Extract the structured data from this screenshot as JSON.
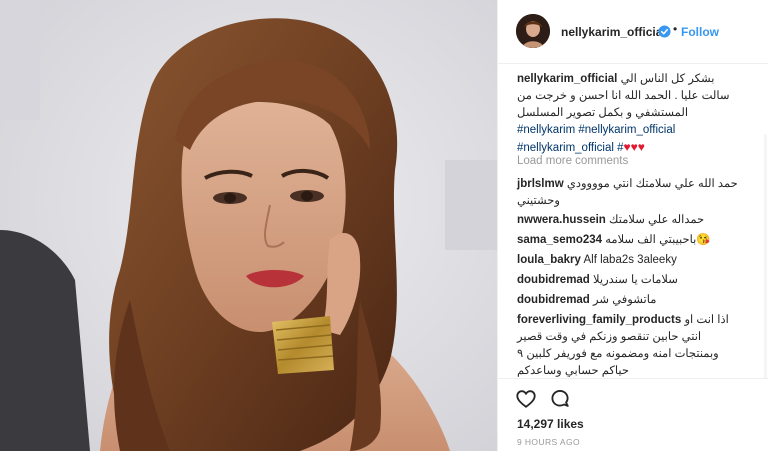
{
  "post": {
    "username": "nellykarim_official",
    "follow_label": "Follow",
    "separator": "•",
    "likes": "14,297 likes",
    "time": "9 HOURS AGO",
    "load_more": "Load more comments"
  },
  "caption": {
    "user": "nellykarim_official",
    "text_line1": "بشكر كل الناس الي",
    "text_line2": "سالت عليا . الحمد الله انا احسن و خرجت من",
    "text_line3": "المستشفي و بكمل تصوير المسلسل",
    "tags_line1": "#nellykarim #nellykarim_official",
    "tags_line2": "#nellykarim_official #",
    "hearts": "♥♥♥"
  },
  "comments": [
    {
      "user": "jbrlslmw",
      "text": "حمد الله علي سلامتك انتي موووودي",
      "text2": "وحشتيني"
    },
    {
      "user": "nwwera.hussein",
      "text": "حمداله علي سلامتك"
    },
    {
      "user": "sama_semo234",
      "text": "باحبيبتي الف سلامه",
      "emoji": "😘"
    },
    {
      "user": "loula_bakry",
      "text": "Alf laba2s 3aleeky"
    },
    {
      "user": "doubidremad",
      "text": "سلامات يا سندريلا"
    },
    {
      "user": "doubidremad",
      "text": "ماتشوفي شر"
    },
    {
      "user": "foreverliving_family_products",
      "text": "اذا انت او",
      "text2": "انتي حابين تنقصو وزنكم في وقت قصير",
      "text3": "وبمنتجات امنه ومضمونه مع فوريفر كلبين ٩",
      "text4": "حياكم حسابي وساعدكم"
    }
  ],
  "icons": {
    "like": "heart-outline-icon",
    "comment": "comment-bubble-icon",
    "verified": "verified-badge-icon"
  },
  "colors": {
    "accent": "#3897f0",
    "hashtag": "#003569",
    "heart": "#e3172d",
    "muted": "#999999"
  }
}
